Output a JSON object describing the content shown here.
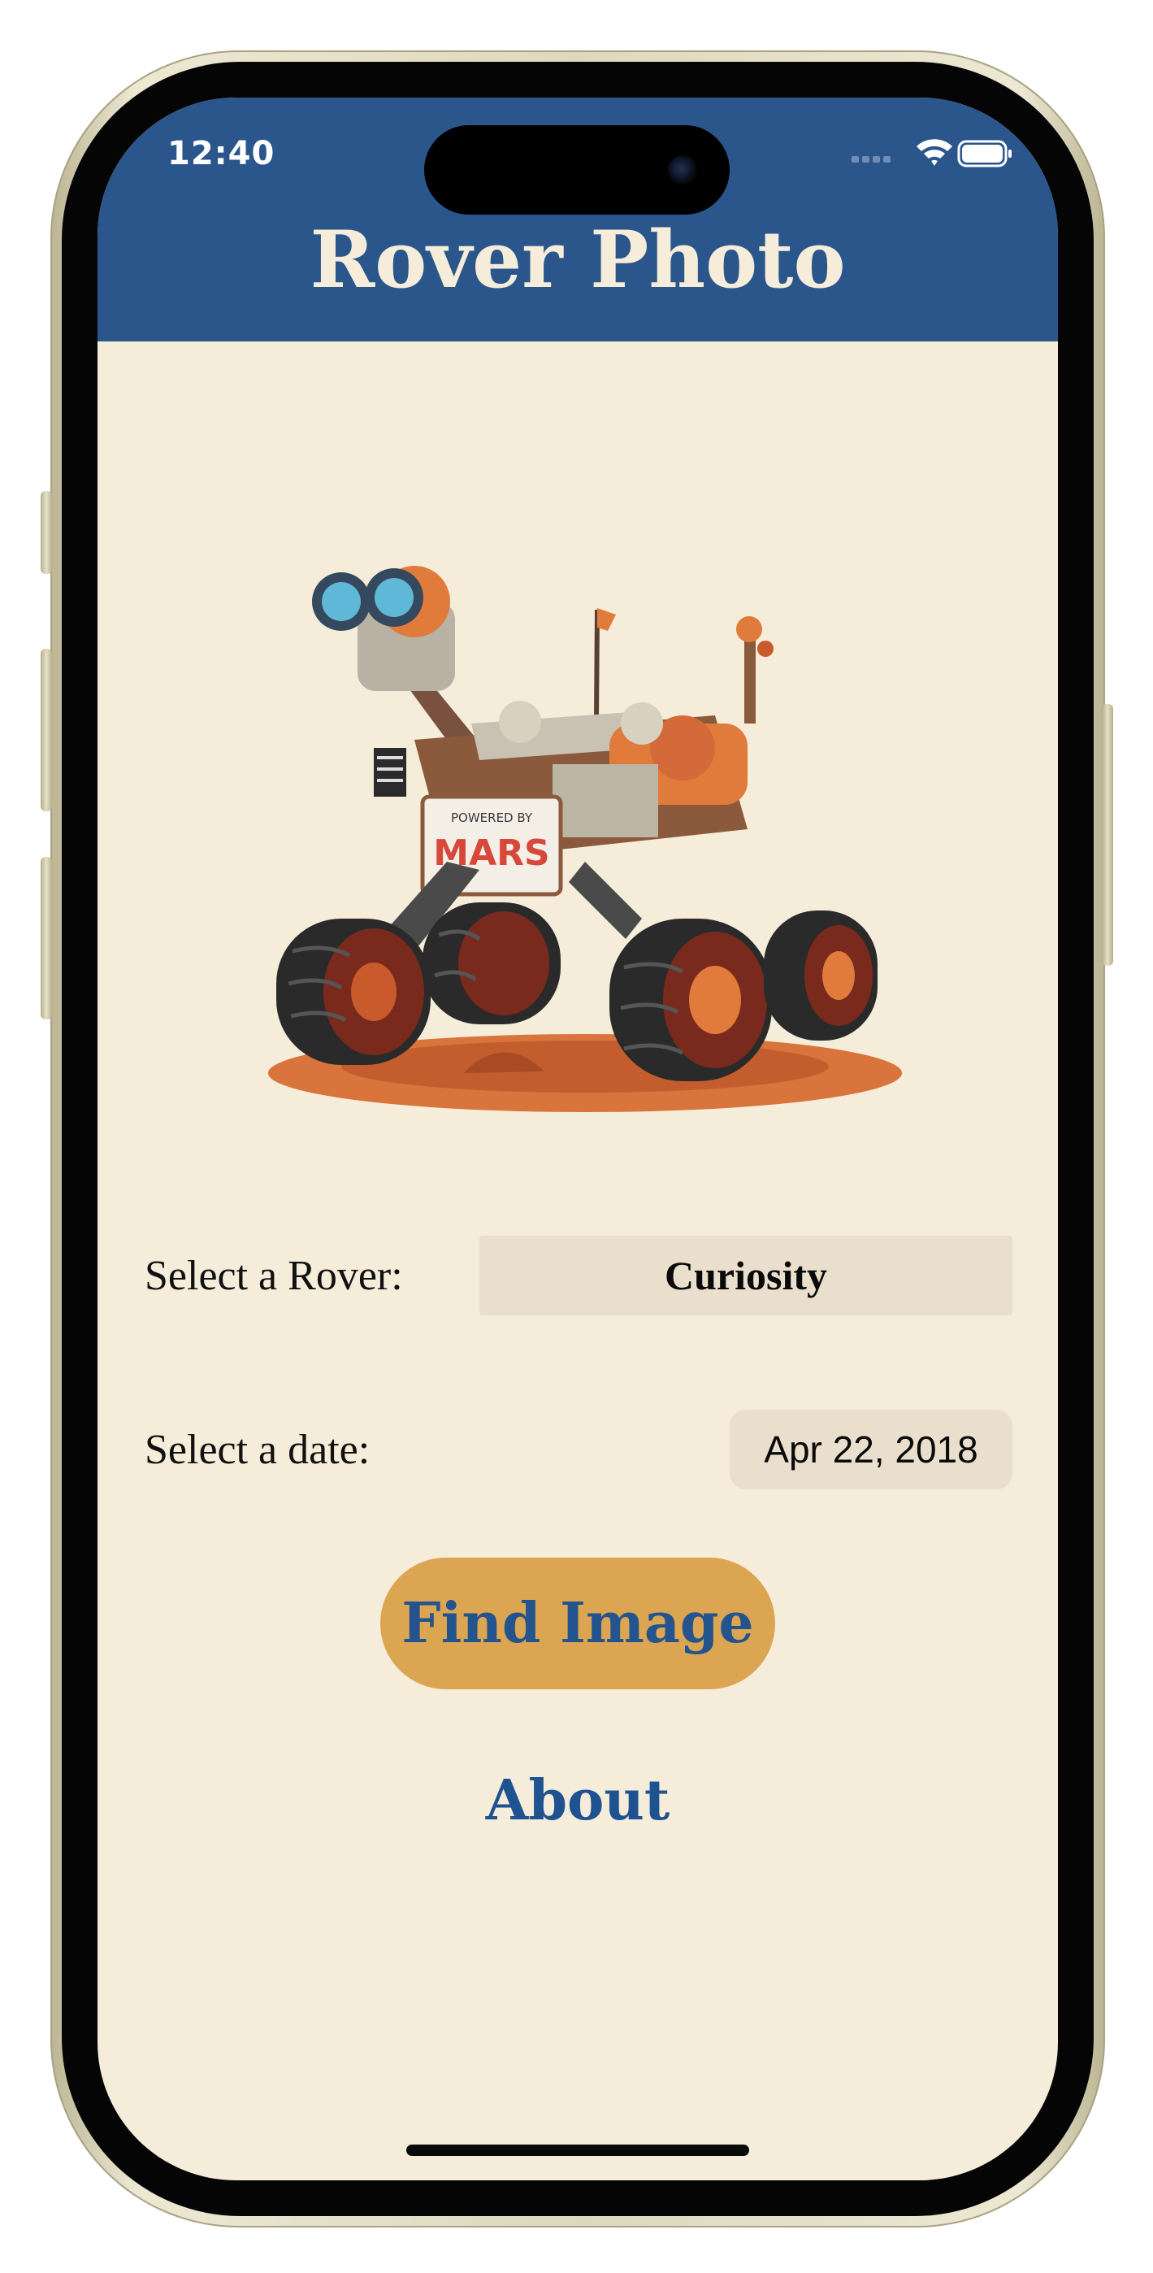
{
  "status_bar": {
    "time": "12:40"
  },
  "header": {
    "title": "Rover Photo"
  },
  "form": {
    "rover_label": "Select a Rover:",
    "rover_value": "Curiosity",
    "date_label": "Select a date:",
    "date_value": "Apr 22, 2018"
  },
  "illustration": {
    "badge_small_text": "POWERED BY",
    "badge_text": "MARS"
  },
  "actions": {
    "find_label": "Find Image",
    "about_label": "About"
  },
  "colors": {
    "header_bg": "#2a568c",
    "screen_bg": "#f5ecd9",
    "button_bg": "#dba552",
    "link": "#1e5291"
  },
  "icons": [
    "signal-icon",
    "wifi-icon",
    "battery-icon"
  ]
}
